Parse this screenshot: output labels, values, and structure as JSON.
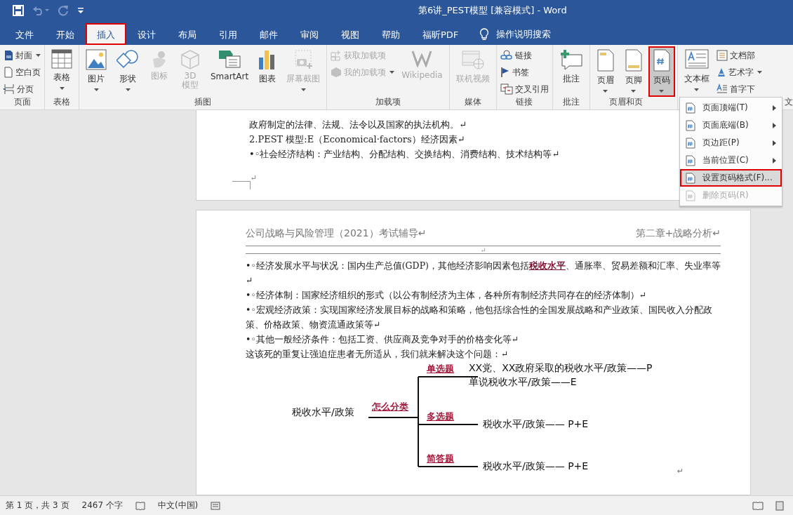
{
  "window": {
    "title": "第6讲_PEST模型 [兼容模式]  -  Word"
  },
  "tabs": [
    {
      "label": "文件",
      "selected": false,
      "highlighted": false
    },
    {
      "label": "开始",
      "selected": false,
      "highlighted": false
    },
    {
      "label": "插入",
      "selected": true,
      "highlighted": true
    },
    {
      "label": "设计",
      "selected": false,
      "highlighted": false
    },
    {
      "label": "布局",
      "selected": false,
      "highlighted": false
    },
    {
      "label": "引用",
      "selected": false,
      "highlighted": false
    },
    {
      "label": "邮件",
      "selected": false,
      "highlighted": false
    },
    {
      "label": "审阅",
      "selected": false,
      "highlighted": false
    },
    {
      "label": "视图",
      "selected": false,
      "highlighted": false
    },
    {
      "label": "帮助",
      "selected": false,
      "highlighted": false
    },
    {
      "label": "福昕PDF",
      "selected": false,
      "highlighted": false
    }
  ],
  "tell_me": "操作说明搜索",
  "ribbon": [
    {
      "label": "页面",
      "items": [
        {
          "kind": "small",
          "label": "封面",
          "disabled": false,
          "dropdown": true
        },
        {
          "kind": "small",
          "label": "空白页",
          "disabled": false,
          "dropdown": false
        },
        {
          "kind": "small",
          "label": "分页",
          "disabled": false,
          "dropdown": false
        }
      ]
    },
    {
      "label": "表格",
      "items": [
        {
          "kind": "large",
          "label": "表格",
          "disabled": false,
          "dropdown": true
        }
      ]
    },
    {
      "label": "插图",
      "items": [
        {
          "kind": "large",
          "label": "图片",
          "disabled": false,
          "dropdown": true
        },
        {
          "kind": "large",
          "label": "形状",
          "disabled": false,
          "dropdown": true
        },
        {
          "kind": "large",
          "label": "图标",
          "disabled": true,
          "dropdown": false,
          "wrap": true
        },
        {
          "kind": "large",
          "label": "3D 模型",
          "disabled": true,
          "dropdown": false,
          "wrap": true
        },
        {
          "kind": "large",
          "label": "SmartArt",
          "disabled": false,
          "dropdown": false
        },
        {
          "kind": "large",
          "label": "图表",
          "disabled": false,
          "dropdown": false
        },
        {
          "kind": "large",
          "label": "屏幕截图",
          "disabled": true,
          "dropdown": true
        }
      ]
    },
    {
      "label": "加载项",
      "items": [
        {
          "kind": "small",
          "label": "获取加载项",
          "disabled": true,
          "dropdown": false
        },
        {
          "kind": "small",
          "label": "我的加载项",
          "disabled": true,
          "dropdown": true
        },
        {
          "kind": "large",
          "label": "Wikipedia",
          "disabled": true,
          "dropdown": false
        }
      ]
    },
    {
      "label": "媒体",
      "items": [
        {
          "kind": "large",
          "label": "联机视频",
          "disabled": true,
          "dropdown": false
        }
      ]
    },
    {
      "label": "链接",
      "items": [
        {
          "kind": "small",
          "label": "链接",
          "disabled": false,
          "dropdown": false
        },
        {
          "kind": "small",
          "label": "书签",
          "disabled": false,
          "dropdown": false
        },
        {
          "kind": "small",
          "label": "交叉引用",
          "disabled": false,
          "dropdown": false
        }
      ]
    },
    {
      "label": "批注",
      "items": [
        {
          "kind": "large",
          "label": "批注",
          "disabled": false,
          "dropdown": false
        }
      ]
    },
    {
      "label": "页眉和页",
      "items": [
        {
          "kind": "large",
          "label": "页眉",
          "disabled": false,
          "dropdown": true
        },
        {
          "kind": "large",
          "label": "页脚",
          "disabled": false,
          "dropdown": true
        },
        {
          "kind": "large",
          "label": "页码",
          "disabled": false,
          "dropdown": true,
          "pressed": true,
          "highlighted": true
        }
      ]
    },
    {
      "label": "文",
      "items": [
        {
          "kind": "large",
          "label": "文本框",
          "disabled": false,
          "dropdown": true
        },
        {
          "kind": "small",
          "label": "文档部",
          "disabled": false,
          "dropdown": false
        },
        {
          "kind": "small",
          "label": "艺术字",
          "disabled": false,
          "dropdown": true
        },
        {
          "kind": "small",
          "label": "首字下",
          "disabled": false,
          "dropdown": false
        }
      ]
    }
  ],
  "page_1": {
    "lines": [
      "政府制定的法律、法规、法令以及国家的执法机构。↵",
      "2.PEST 模型:E（Economical·factors）经济因素↵",
      "•◦社会经济结构：产业结构、分配结构、交换结构、消费结构、技术结构等↵"
    ],
    "end_mark": "↵"
  },
  "page_2": {
    "header_left": "公司战略与风险管理（2021）考试辅导↵",
    "header_right": "第二章+战略分析↵",
    "header_mark": "↵",
    "paragraphs": [
      "•◦经济发展水平与状况：国内生产总值(GDP)，其他经济影响因素包括**税收水平**、通胀率、贸易差额和汇率、失业率等↵",
      "•◦经济体制：国家经济组织的形式（以公有制经济为主体，各种所有制经济共同存在的经济体制）↵",
      "•◦宏观经济政策：实现国家经济发展目标的战略和策略，他包括综合性的全国发展战略和产业政策、国民收入分配政策、价格政策、物资流通政策等↵",
      "•◦其他一般经济条件：包括工资、供应商及竞争对手的价格变化等↵",
      "这该死的重复让强迫症患者无所适从，我们就来解决这个问题：↵"
    ],
    "diagram": {
      "root": "税收水平/政策",
      "connector": "怎么分类",
      "branches": [
        {
          "label": "单选题",
          "leaves": [
            "XX党、XX政府采取的税收水平/政策——P",
            "单说税收水平/政策——E"
          ]
        },
        {
          "label": "多选题",
          "leaves": [
            "税收水平/政策——  P+E"
          ]
        },
        {
          "label": "简答题",
          "leaves": [
            "税收水平/政策——  P+E"
          ]
        }
      ],
      "end_mark": "↵"
    }
  },
  "menu": [
    {
      "label": "页面顶端(T)",
      "submenu": true,
      "disabled": false,
      "highlighted": false
    },
    {
      "label": "页面底端(B)",
      "submenu": true,
      "disabled": false,
      "highlighted": false
    },
    {
      "label": "页边距(P)",
      "submenu": true,
      "disabled": false,
      "highlighted": false
    },
    {
      "label": "当前位置(C)",
      "submenu": true,
      "disabled": false,
      "highlighted": false
    },
    {
      "label": "设置页码格式(F)...",
      "submenu": false,
      "disabled": false,
      "highlighted": true
    },
    {
      "label": "删除页码(R)",
      "submenu": false,
      "disabled": true,
      "highlighted": false
    }
  ],
  "status_bar": {
    "page": "第 1 页，共 3 页",
    "words": "2467 个字",
    "language": "中文(中国)"
  }
}
